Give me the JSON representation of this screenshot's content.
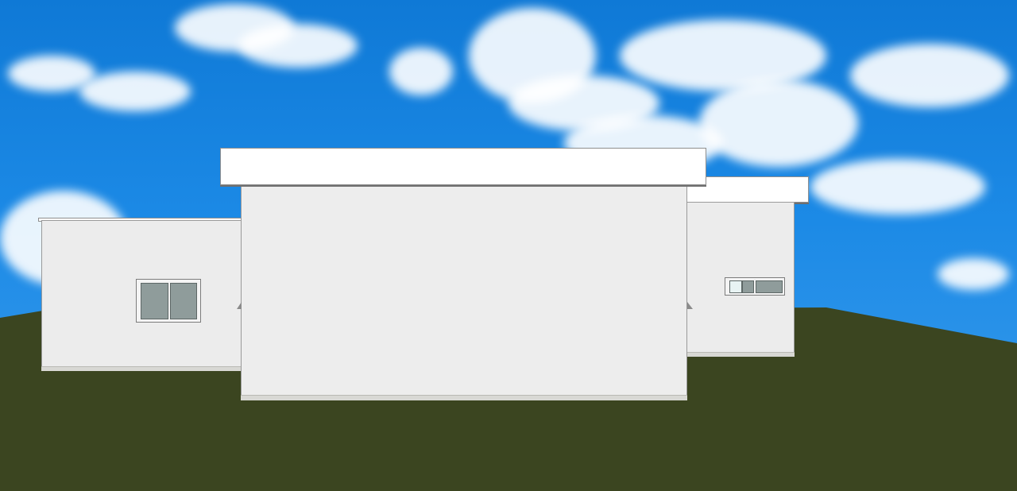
{
  "scene": {
    "type": "3d-elevation-view",
    "colors": {
      "sky": "#1c8ae6",
      "cloud": "#ffffff",
      "ground": "#3b4520",
      "wall": "#ececec",
      "roof": "#ffffff",
      "window_glass": "#8f9c9b"
    },
    "components": [
      "sky-background",
      "clouds",
      "grass-ground",
      "left-wing",
      "center-block",
      "right-wing"
    ]
  }
}
